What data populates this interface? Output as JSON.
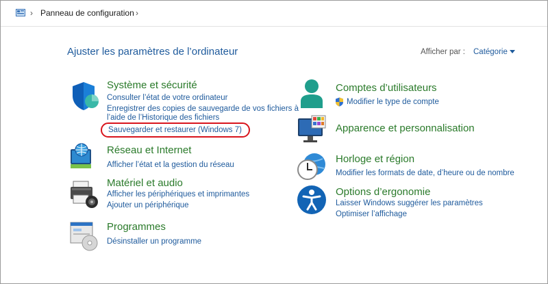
{
  "address": {
    "breadcrumb": "Panneau de configuration"
  },
  "header": {
    "title": "Ajuster les paramètres de l’ordinateur",
    "view_by_label": "Afficher par :",
    "view_by_value": "Catégorie"
  },
  "left": [
    {
      "icon": "shield-icon",
      "title": "Système et sécurité",
      "links": [
        "Consulter l’état de votre ordinateur",
        "Enregistrer des copies de sauvegarde de vos fichiers à",
        "l’aide de l’Historique des fichiers",
        "Sauvegarder et restaurer (Windows 7)"
      ]
    },
    {
      "icon": "network-globe-icon",
      "title": "Réseau et Internet",
      "links": [
        "Afficher l’état et la gestion du réseau"
      ]
    },
    {
      "icon": "printer-icon",
      "title": "Matériel et audio",
      "links": [
        "Afficher les périphériques et imprimantes",
        "Ajouter un périphérique"
      ]
    },
    {
      "icon": "programs-disc-icon",
      "title": "Programmes",
      "links": [
        "Désinstaller un programme"
      ]
    }
  ],
  "right": [
    {
      "icon": "user-accounts-icon",
      "title": "Comptes d’utilisateurs",
      "links": [
        "Modifier le type de compte"
      ]
    },
    {
      "icon": "monitor-palette-icon",
      "title": "Apparence et personnalisation",
      "links": []
    },
    {
      "icon": "clock-globe-icon",
      "title": "Horloge et région",
      "links": [
        "Modifier les formats de date, d’heure ou de nombre"
      ]
    },
    {
      "icon": "accessibility-icon",
      "title": "Options d’ergonomie",
      "links": [
        "Laisser Windows suggérer les paramètres",
        "Optimiser l’affichage"
      ]
    }
  ],
  "colors": {
    "title_green": "#2a7a2a",
    "link_blue": "#1e5a9c",
    "highlight_red": "#d8141c"
  }
}
